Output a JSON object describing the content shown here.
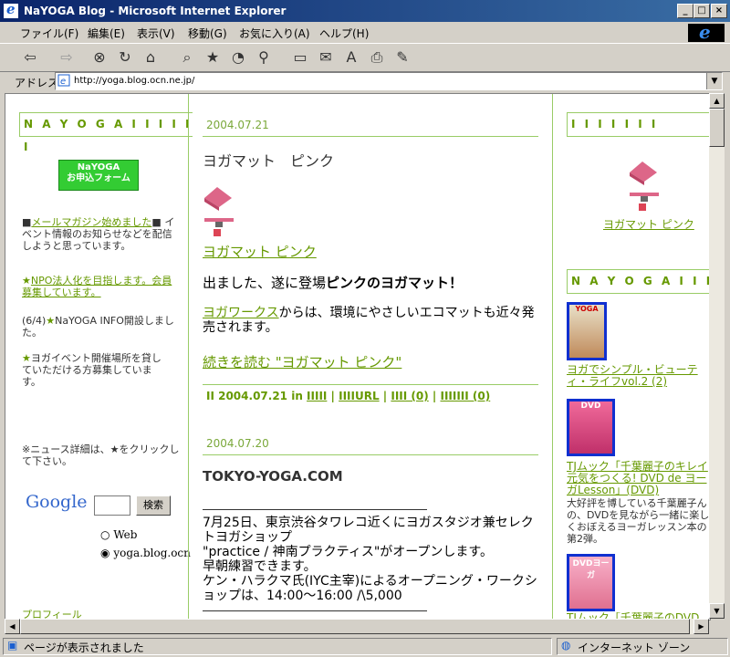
{
  "window": {
    "title": "NaYOGA Blog - Microsoft Internet Explorer",
    "buttons": [
      "_",
      "□",
      "×"
    ]
  },
  "menu": [
    "ファイル(F)",
    "編集(E)",
    "表示(V)",
    "移動(G)",
    "お気に入り(A)",
    "ヘルプ(H)"
  ],
  "address": {
    "label": "アドレス",
    "url": "http://yoga.blog.ocn.ne.jp/"
  },
  "left": {
    "header": "N A Y O G A I I I I I I",
    "banner_line1": "NaYOGA",
    "banner_line2": "お申込フォーム",
    "news1_link": "メールマガジン始めました",
    "news1_text": "イベント情報のお知らせなどを配信しようと思っています。",
    "news2_link": "NPO法人化を目指します。会員募集しています。",
    "news3_text": "(6/4)",
    "news3_rest": "NaYOGA INFO開設しました。",
    "news4_text": "ヨガイベント開催場所を貸していただける方募集しています。",
    "footnote": "※ニュース詳細は、★をクリックして下さい。",
    "google_logo": "Google",
    "search_button": "検索",
    "radio_web": "Web",
    "radio_site": "yoga.blog.ocn.ne.jp",
    "profile_link": "プロフィール"
  },
  "main": {
    "post1": {
      "date": "2004.07.21",
      "title": "ヨガマット　ピンク",
      "image_link": "ヨガマット ピンク",
      "body1_a": "出ました、遂に登場",
      "body1_b": "ピンクのヨガマット！",
      "body2_link": "ヨガワークス",
      "body2_rest": "からは、環境にやさしいエコマットも近々発売されます。",
      "more_link": "続きを読む \"ヨガマット ピンク\"",
      "footer_prefix": "II 2004.07.21 in",
      "footer_cat": "IIIII",
      "footer_url": "IIIIURL",
      "footer_comments": "IIII (0)",
      "footer_trackbacks": "IIIIIII (0)"
    },
    "post2": {
      "date": "2004.07.20",
      "title": "TOKYO-YOGA.COM",
      "body": [
        "7月25日、東京渋谷タワレコ近くにヨガスタジオ兼セレクトヨガショップ",
        "\"practice / 神南プラクティス\"がオープンします。",
        "早朝練習できます。",
        "ケン・ハラクマ氏(IYC主宰)によるオープニング・ワークショップは、14:00～16:00 /\\5,000"
      ]
    }
  },
  "right": {
    "header1": "I I I I I I I",
    "item_link": "ヨガマット ピンク",
    "header2": "N A Y O G A I I I",
    "book1_link": "ヨガでシンプル・ビューティ・ライフvol.2 (2)",
    "book1_cover": "YOGA",
    "book2_link": "TJムック「千葉麗子のキレイ元気をつくる! DVD de ヨーガLesson」(DVD)",
    "book2_cover": "DVD",
    "book2_desc": "大好評を博している千葉麗子んの、DVDを見ながら一緒に楽しくおぼえるヨーガレッスン本の第2弾。",
    "book3_cover": "DVDヨーガ",
    "book3_partial": "TJムック「千葉麗子のDVD"
  },
  "status": {
    "left": "ページが表示されました",
    "zone": "インターネット ゾーン"
  },
  "colors": {
    "accent": "#669900",
    "title_bar": "#0a246a",
    "border_green": "#99cc66",
    "thumb_border": "#1030d0"
  }
}
